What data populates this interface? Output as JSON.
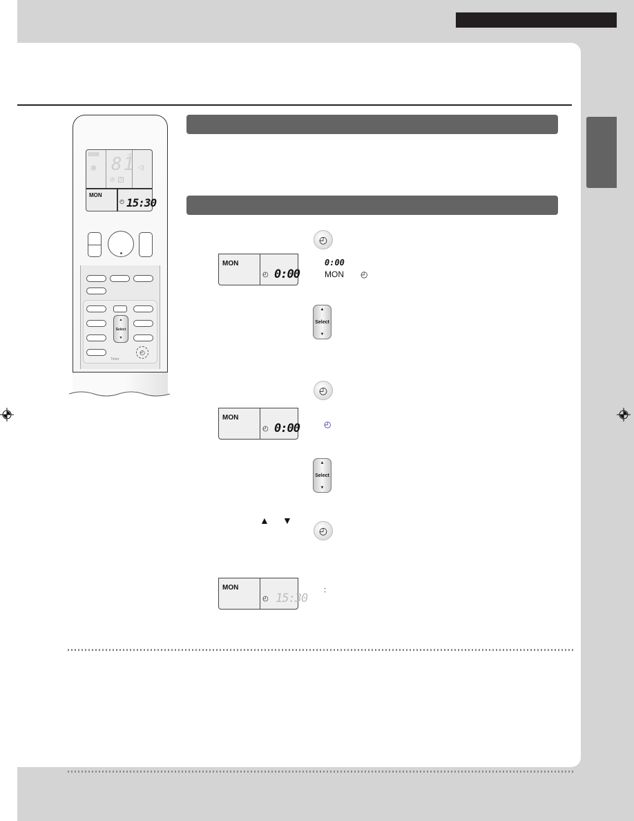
{
  "page": {
    "colors": {
      "background_gray": "#d4d4d4",
      "header_bar": "#231f20",
      "section_bar": "#646464",
      "side_tab": "#636363",
      "dotted_rule": "#8a8a8a"
    }
  },
  "remote": {
    "lcd": {
      "temperature": "81",
      "temp_unit": "°F",
      "fan_mode": "A",
      "day": "MON",
      "time": "15:30"
    },
    "select_button": {
      "up": "▲",
      "label": "Select",
      "down": "▼"
    },
    "timer_label": "Timer",
    "timer_icon": "clock-icon"
  },
  "steps": {
    "step1": {
      "button_icon": "clock-icon",
      "display": {
        "day": "MON",
        "time": "0:00",
        "day_blinking": true,
        "clock_blinking": true
      },
      "legend": {
        "time": "0:00",
        "day": "MON",
        "clock_icon": "clock-icon"
      }
    },
    "step2": {
      "select_button": {
        "up": "▲",
        "label": "Select",
        "down": "▼"
      }
    },
    "step3": {
      "button_icon": "clock-icon",
      "display": {
        "day": "MON",
        "time": "0:00",
        "clock_blinking": true
      },
      "legend": {
        "clock_icon": "clock-icon"
      }
    },
    "step4": {
      "select_button": {
        "up": "▲",
        "label": "Select",
        "down": "▼"
      },
      "arrows": {
        "up": "▲",
        "down": "▼"
      }
    },
    "step5": {
      "button_icon": "clock-icon",
      "display": {
        "day": "MON",
        "time": "15:30",
        "colon_blinking": true
      },
      "legend": {
        "colon": ":"
      }
    }
  },
  "glyphs": {
    "clock": "◴",
    "clock_alt": "⊕"
  }
}
